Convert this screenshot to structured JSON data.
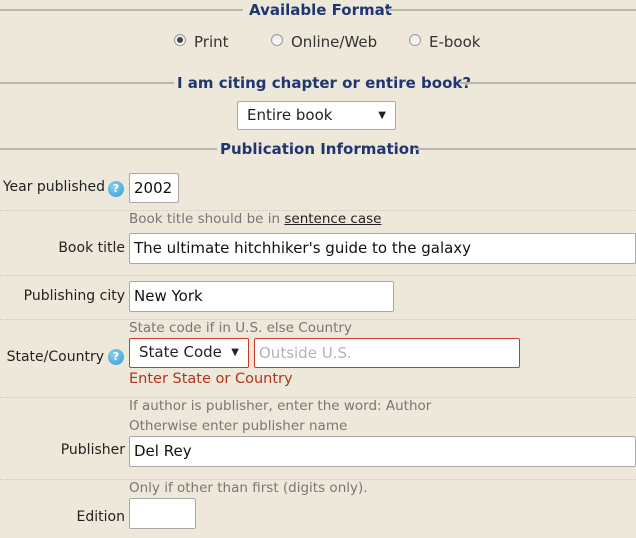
{
  "sections": {
    "available_format": "Available Format",
    "citing": "I am citing chapter or entire book?",
    "publication": "Publication Information"
  },
  "formats": [
    {
      "label": "Print",
      "selected": true
    },
    {
      "label": "Online/Web",
      "selected": false
    },
    {
      "label": "E-book",
      "selected": false
    }
  ],
  "citing_select": {
    "value": "Entire book"
  },
  "fields": {
    "year": {
      "label": "Year published",
      "value": "2002",
      "help_icon": "?"
    },
    "book_title": {
      "hint_prefix": "Book title should be in ",
      "hint_link": "sentence case",
      "label": "Book title",
      "value": "The ultimate hitchhiker's guide to the galaxy"
    },
    "city": {
      "label": "Publishing city",
      "value": "New York"
    },
    "state_country": {
      "hint": "State code if in U.S. else Country",
      "label": "State/Country",
      "help_icon": "?",
      "select_value": "State Code",
      "placeholder": "Outside U.S.",
      "error": "Enter State or Country"
    },
    "publisher": {
      "hint1": "If author is publisher, enter the word: Author",
      "hint2": "Otherwise enter publisher name",
      "label": "Publisher",
      "value": "Del Rey"
    },
    "edition": {
      "hint": "Only if other than first (digits only).",
      "label": "Edition",
      "value": ""
    }
  },
  "colors": {
    "background": "#ede8da",
    "section_title": "#1f3672",
    "error": "#b0341c"
  }
}
